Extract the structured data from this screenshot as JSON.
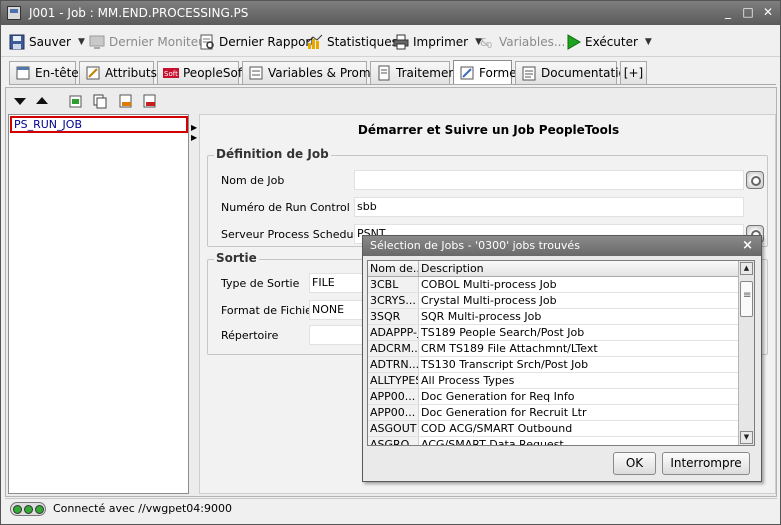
{
  "window": {
    "title": "J001 - Job : MM.END.PROCESSING.PS",
    "minimize": "_",
    "maximize": "□",
    "close": "✕"
  },
  "toolbar": {
    "save": "Sauver",
    "monitor": "Dernier Moniteur",
    "report": "Dernier Rapport",
    "stats": "Statistiques",
    "print": "Imprimer",
    "variables": "Variables...",
    "execute": "Exécuter"
  },
  "tabs": [
    {
      "label": "En-tête"
    },
    {
      "label": "Attributs"
    },
    {
      "label": "PeopleSoft"
    },
    {
      "label": "Variables & Prompts"
    },
    {
      "label": "Traitement"
    },
    {
      "label": "Forme"
    },
    {
      "label": "Documentation"
    },
    {
      "label": "[+]"
    }
  ],
  "left": {
    "selected_job": "PS_RUN_JOB"
  },
  "form": {
    "title": "Démarrer et Suivre un Job PeopleTools",
    "job_def": {
      "legend": "Définition de Job",
      "job_name_label": "Nom de Job",
      "job_name_value": "",
      "run_control_label": "Numéro de Run Control",
      "run_control_value": "sbb",
      "server_label": "Serveur Process Scheduler",
      "server_value": "PSNT"
    },
    "output": {
      "legend": "Sortie",
      "type_label": "Type de Sortie",
      "type_value": "FILE",
      "format_label": "Format de Fichier",
      "format_value": "NONE",
      "dir_label": "Répertoire",
      "dir_value": ""
    }
  },
  "status": {
    "text": "Connecté avec //vwgpet04:9000"
  },
  "dialog": {
    "title": "Sélection de Jobs - '0300' jobs trouvés",
    "close": "×",
    "headers": [
      "Nom de...",
      "Description"
    ],
    "rows": [
      {
        "name": "3CBL",
        "desc": "COBOL Multi-process Job"
      },
      {
        "name": "3CRYS...",
        "desc": "Crystal Multi-process Job"
      },
      {
        "name": "3SQR",
        "desc": "SQR Multi-process Job"
      },
      {
        "name": "ADAPPP-J",
        "desc": "TS189 People Search/Post Job"
      },
      {
        "name": "ADCRM...",
        "desc": "CRM TS189 File Attachmnt/LText"
      },
      {
        "name": "ADTRN...",
        "desc": "TS130 Transcript Srch/Post Job"
      },
      {
        "name": "ALLTYPES",
        "desc": "All Process Types"
      },
      {
        "name": "APP00...",
        "desc": "Doc Generation for Req Info"
      },
      {
        "name": "APP00...",
        "desc": "Doc Generation for Recruit Ltr"
      },
      {
        "name": "ASGOUT",
        "desc": "COD ACG/SMART Outbound"
      },
      {
        "name": "ASGRQ",
        "desc": "ACG/SMART Data Request"
      }
    ],
    "ok": "OK",
    "cancel": "Interrompre"
  }
}
